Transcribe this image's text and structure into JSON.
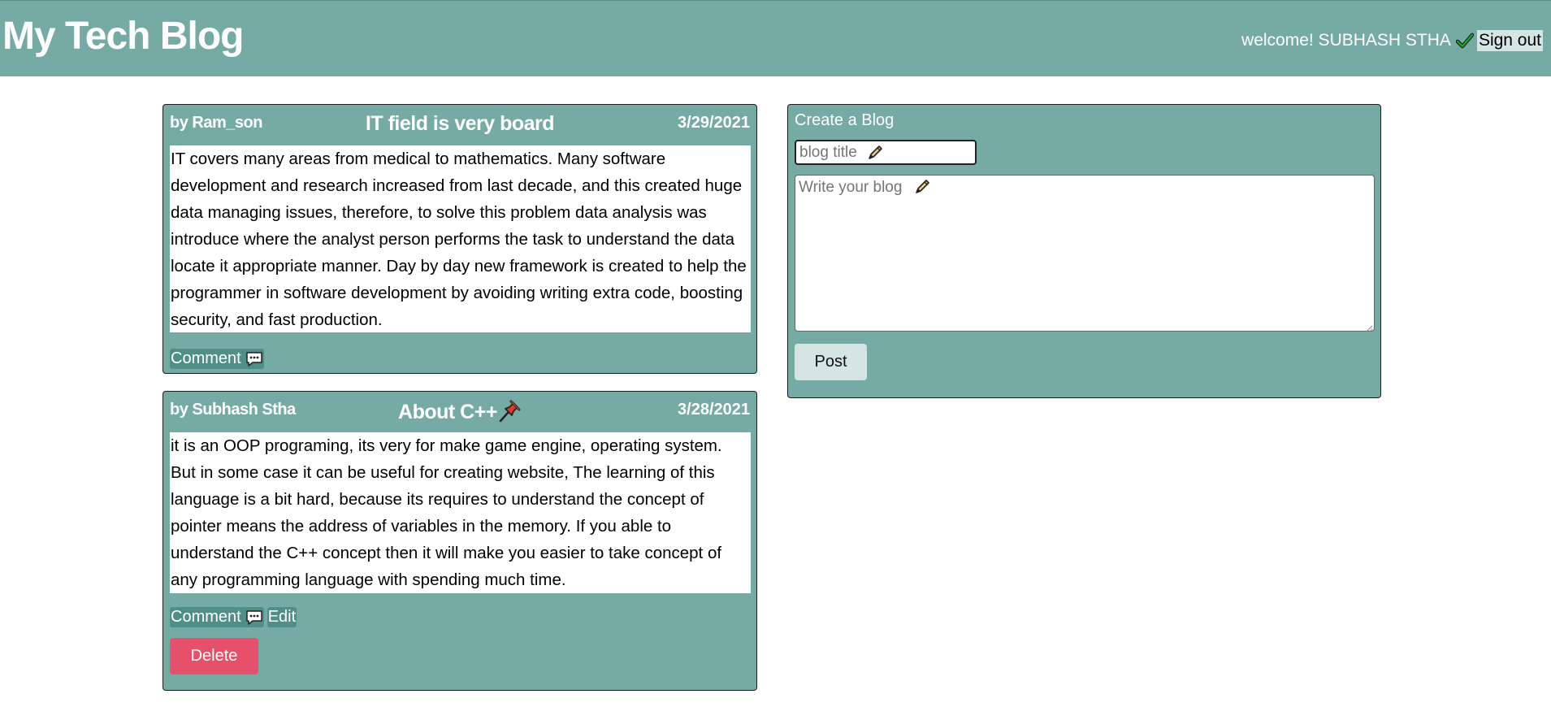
{
  "header": {
    "site_title": "My Tech Blog",
    "welcome_text": "welcome! SUBHASH STHA",
    "check_icon": "checkmark-icon",
    "signout_label": "Sign out"
  },
  "posts": [
    {
      "author": "by Ram_son",
      "title": "IT field is very board",
      "date": "3/29/2021",
      "body": "IT covers many areas from medical to mathematics. Many software development and research increased from last decade, and this created huge data managing issues, therefore, to solve this problem data analysis was introduce where the analyst person performs the task to understand the data locate it appropriate manner. Day by day new framework is created to help the programmer in software development by avoiding writing extra code, boosting security, and fast production.",
      "comment_label": "Comment"
    },
    {
      "author": "by Subhash Stha",
      "title": "About C++",
      "title_icon": "pushpin-icon",
      "date": "3/28/2021",
      "body": "it is an OOP programing, its very for make game engine, operating system. But in some case it can be useful for creating website, The learning of this language is a bit hard, because its requires to understand the concept of pointer means the address of variables in the memory. If you able to understand the C++ concept then it will make you easier to take concept of any programming language with spending much time.",
      "comment_label": "Comment",
      "edit_label": "Edit",
      "delete_label": "Delete"
    }
  ],
  "create": {
    "heading": "Create a Blog",
    "title_placeholder": "blog title",
    "body_placeholder": "Write your blog",
    "post_label": "Post"
  },
  "colors": {
    "header_bg": "#75aaa5",
    "card_bg": "#75aaa5",
    "delete_bg": "#e6506a",
    "button_light": "#d5e5e3"
  }
}
